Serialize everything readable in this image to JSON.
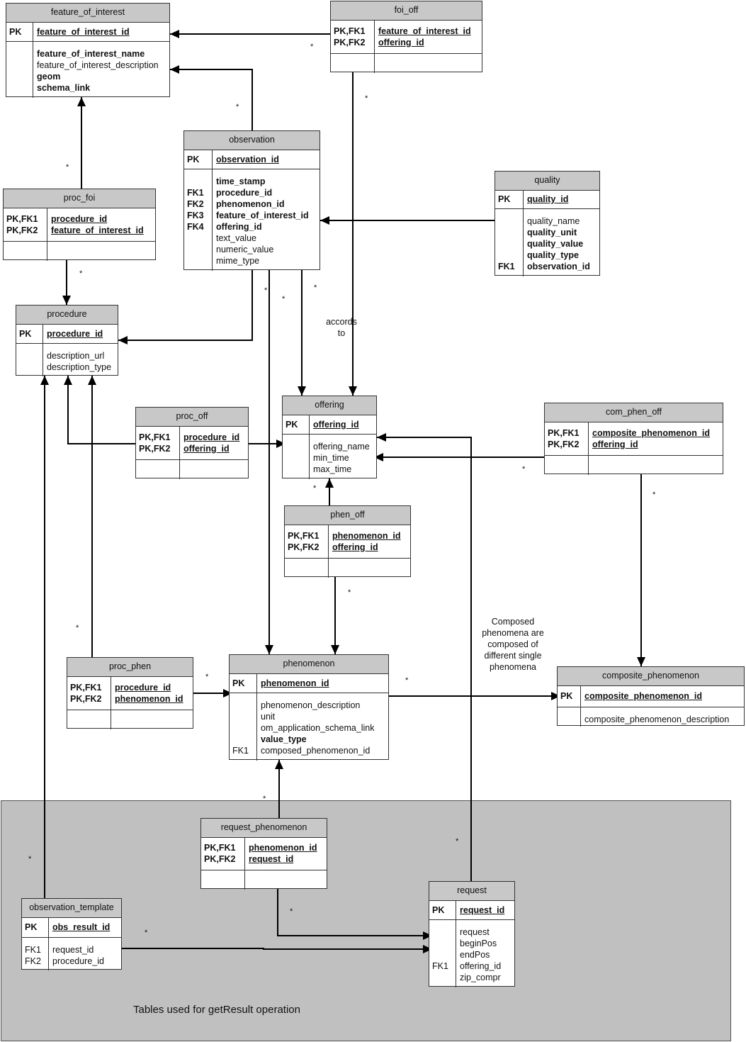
{
  "region_label": "Tables used for getResult operation",
  "notes": {
    "accords_to": "accords\nto",
    "composed": "Composed\nphenomena are\ncomposed of\ndifferent single\nphenomena"
  },
  "tables": [
    {
      "id": "feature_of_interest",
      "name": "feature_of_interest",
      "pk": [
        {
          "key": "PK",
          "field": "feature_of_interest_id"
        }
      ],
      "attrs": [
        {
          "key": "",
          "field": "feature_of_interest_name",
          "bold": true
        },
        {
          "key": "",
          "field": "feature_of_interest_description",
          "bold": false
        },
        {
          "key": "",
          "field": "geom",
          "bold": true
        },
        {
          "key": "",
          "field": "schema_link",
          "bold": true
        }
      ]
    },
    {
      "id": "foi_off",
      "name": "foi_off",
      "pk": [
        {
          "key": "PK,FK1",
          "field": "feature_of_interest_id"
        },
        {
          "key": "PK,FK2",
          "field": "offering_id"
        }
      ],
      "attrs": []
    },
    {
      "id": "observation",
      "name": "observation",
      "pk": [
        {
          "key": "PK",
          "field": "observation_id"
        }
      ],
      "attrs": [
        {
          "key": "",
          "field": "time_stamp",
          "bold": true
        },
        {
          "key": "FK1",
          "field": "procedure_id",
          "bold": true
        },
        {
          "key": "FK2",
          "field": "phenomenon_id",
          "bold": true
        },
        {
          "key": "FK3",
          "field": "feature_of_interest_id",
          "bold": true
        },
        {
          "key": "FK4",
          "field": "offering_id",
          "bold": true
        },
        {
          "key": "",
          "field": "text_value",
          "bold": false
        },
        {
          "key": "",
          "field": "numeric_value",
          "bold": false
        },
        {
          "key": "",
          "field": "mime_type",
          "bold": false
        }
      ]
    },
    {
      "id": "proc_foi",
      "name": "proc_foi",
      "pk": [
        {
          "key": "PK,FK1",
          "field": "procedure_id"
        },
        {
          "key": "PK,FK2",
          "field": "feature_of_interest_id"
        }
      ],
      "attrs": []
    },
    {
      "id": "quality",
      "name": "quality",
      "pk": [
        {
          "key": "PK",
          "field": "quality_id"
        }
      ],
      "attrs": [
        {
          "key": "",
          "field": "quality_name",
          "bold": false
        },
        {
          "key": "",
          "field": "quality_unit",
          "bold": true
        },
        {
          "key": "",
          "field": "quality_value",
          "bold": true
        },
        {
          "key": "",
          "field": "quality_type",
          "bold": true
        },
        {
          "key": "FK1",
          "field": "observation_id",
          "bold": true
        }
      ]
    },
    {
      "id": "procedure",
      "name": "procedure",
      "pk": [
        {
          "key": "PK",
          "field": "procedure_id"
        }
      ],
      "attrs": [
        {
          "key": "",
          "field": "description_url",
          "bold": false
        },
        {
          "key": "",
          "field": "description_type",
          "bold": false
        }
      ]
    },
    {
      "id": "offering",
      "name": "offering",
      "pk": [
        {
          "key": "PK",
          "field": "offering_id"
        }
      ],
      "attrs": [
        {
          "key": "",
          "field": "offering_name",
          "bold": false
        },
        {
          "key": "",
          "field": "min_time",
          "bold": false
        },
        {
          "key": "",
          "field": "max_time",
          "bold": false
        }
      ]
    },
    {
      "id": "proc_off",
      "name": "proc_off",
      "pk": [
        {
          "key": "PK,FK1",
          "field": "procedure_id"
        },
        {
          "key": "PK,FK2",
          "field": "offering_id"
        }
      ],
      "attrs": []
    },
    {
      "id": "com_phen_off",
      "name": "com_phen_off",
      "pk": [
        {
          "key": "PK,FK1",
          "field": "composite_phenomenon_id"
        },
        {
          "key": "PK,FK2",
          "field": "offering_id"
        }
      ],
      "attrs": []
    },
    {
      "id": "phen_off",
      "name": "phen_off",
      "pk": [
        {
          "key": "PK,FK1",
          "field": "phenomenon_id"
        },
        {
          "key": "PK,FK2",
          "field": "offering_id"
        }
      ],
      "attrs": []
    },
    {
      "id": "phenomenon",
      "name": "phenomenon",
      "pk": [
        {
          "key": "PK",
          "field": "phenomenon_id"
        }
      ],
      "attrs": [
        {
          "key": "",
          "field": "phenomenon_description",
          "bold": false
        },
        {
          "key": "",
          "field": "unit",
          "bold": false
        },
        {
          "key": "",
          "field": "om_application_schema_link",
          "bold": false
        },
        {
          "key": "",
          "field": "value_type",
          "bold": true
        },
        {
          "key": "FK1",
          "field": "composed_phenomenon_id",
          "bold": false
        }
      ]
    },
    {
      "id": "proc_phen",
      "name": "proc_phen",
      "pk": [
        {
          "key": "PK,FK1",
          "field": "procedure_id"
        },
        {
          "key": "PK,FK2",
          "field": "phenomenon_id"
        }
      ],
      "attrs": []
    },
    {
      "id": "composite_phenomenon",
      "name": "composite_phenomenon",
      "pk": [
        {
          "key": "PK",
          "field": "composite_phenomenon_id"
        }
      ],
      "attrs": [
        {
          "key": "",
          "field": "composite_phenomenon_description",
          "bold": false
        }
      ]
    },
    {
      "id": "request_phenomenon",
      "name": "request_phenomenon",
      "pk": [
        {
          "key": "PK,FK1",
          "field": "phenomenon_id"
        },
        {
          "key": "PK,FK2",
          "field": "request_id"
        }
      ],
      "attrs": []
    },
    {
      "id": "request",
      "name": "request",
      "pk": [
        {
          "key": "PK",
          "field": "request_id"
        }
      ],
      "attrs": [
        {
          "key": "",
          "field": "request",
          "bold": false
        },
        {
          "key": "",
          "field": "beginPos",
          "bold": false
        },
        {
          "key": "",
          "field": "endPos",
          "bold": false
        },
        {
          "key": "FK1",
          "field": "offering_id",
          "bold": false
        },
        {
          "key": "",
          "field": "zip_compr",
          "bold": false
        }
      ]
    },
    {
      "id": "observation_template",
      "name": "observation_template",
      "pk": [
        {
          "key": "PK",
          "field": "obs_result_id"
        }
      ],
      "attrs": [
        {
          "key": "FK1",
          "field": "request_id",
          "bold": false
        },
        {
          "key": "FK2",
          "field": "procedure_id",
          "bold": false
        }
      ]
    }
  ],
  "relationships": [
    {
      "from": "foi_off",
      "to": "feature_of_interest",
      "multiplicity": "*"
    },
    {
      "from": "observation",
      "to": "feature_of_interest",
      "multiplicity": "*"
    },
    {
      "from": "proc_foi",
      "to": "feature_of_interest",
      "multiplicity": "*"
    },
    {
      "from": "foi_off",
      "to": "offering",
      "multiplicity": "*"
    },
    {
      "from": "quality",
      "to": "observation",
      "multiplicity": ""
    },
    {
      "from": "proc_foi",
      "to": "procedure",
      "multiplicity": "*"
    },
    {
      "from": "observation",
      "to": "procedure",
      "multiplicity": "*"
    },
    {
      "from": "observation",
      "to": "offering",
      "multiplicity": "*"
    },
    {
      "from": "observation",
      "to": "phenomenon",
      "multiplicity": "*"
    },
    {
      "from": "proc_off",
      "to": "procedure",
      "multiplicity": ""
    },
    {
      "from": "proc_off",
      "to": "offering",
      "multiplicity": ""
    },
    {
      "from": "proc_phen",
      "to": "procedure",
      "multiplicity": "*"
    },
    {
      "from": "com_phen_off",
      "to": "offering",
      "multiplicity": "*"
    },
    {
      "from": "com_phen_off",
      "to": "composite_phenomenon",
      "multiplicity": "*"
    },
    {
      "from": "phen_off",
      "to": "offering",
      "multiplicity": "*"
    },
    {
      "from": "phen_off",
      "to": "phenomenon",
      "multiplicity": "*"
    },
    {
      "from": "proc_phen",
      "to": "phenomenon",
      "multiplicity": "*"
    },
    {
      "from": "phenomenon",
      "to": "composite_phenomenon",
      "multiplicity": "*"
    },
    {
      "from": "request",
      "to": "offering",
      "multiplicity": "*"
    },
    {
      "from": "request_phenomenon",
      "to": "phenomenon",
      "multiplicity": "*"
    },
    {
      "from": "request_phenomenon",
      "to": "request",
      "multiplicity": "*"
    },
    {
      "from": "observation_template",
      "to": "request",
      "multiplicity": "*"
    },
    {
      "from": "observation_template",
      "to": "procedure",
      "multiplicity": "*"
    }
  ]
}
